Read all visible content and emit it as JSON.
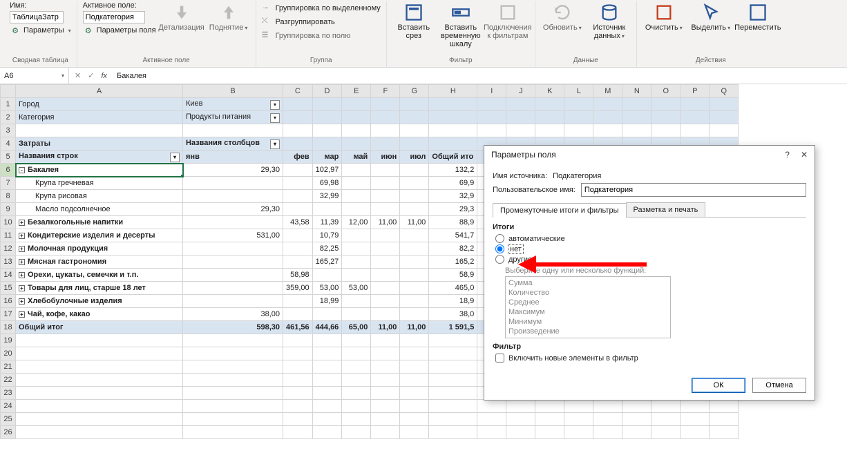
{
  "ribbon": {
    "group1": {
      "name_label": "Имя:",
      "name_value": "ТаблицаЗатр",
      "params_label": "Параметры",
      "group_label": "Сводная таблица"
    },
    "group2": {
      "active_label": "Активное поле:",
      "active_value": "Подкатегория",
      "field_params": "Параметры поля",
      "detail": "Детализация",
      "raise": "Поднятие",
      "group_label": "Активное поле"
    },
    "group3": {
      "by_selection": "Группировка по выделенному",
      "ungroup": "Разгруппировать",
      "by_field": "Группировка по полю",
      "group_label": "Группа"
    },
    "group4": {
      "slicer1": "Вставить",
      "slicer2": "срез",
      "timeline1": "Вставить",
      "timeline2": "временную шкалу",
      "connections1": "Подключения",
      "connections2": "к фильтрам",
      "group_label": "Фильтр"
    },
    "group5": {
      "refresh": "Обновить",
      "source1": "Источник",
      "source2": "данных",
      "group_label": "Данные"
    },
    "group6": {
      "clear": "Очистить",
      "select": "Выделить",
      "move": "Переместить",
      "group_label": "Действия"
    }
  },
  "namebox": {
    "value": "A6"
  },
  "formula": {
    "value": "Бакалея"
  },
  "columns": [
    "A",
    "B",
    "C",
    "D",
    "E",
    "F",
    "G",
    "H",
    "I",
    "J",
    "K",
    "L",
    "M",
    "N",
    "O",
    "P",
    "Q"
  ],
  "sheet": {
    "filterRows": [
      {
        "row": 1,
        "label": "Город",
        "value": "Киев"
      },
      {
        "row": 2,
        "label": "Категория",
        "value": "Продукты питания"
      }
    ],
    "pivotHeader": {
      "row": 4,
      "rowLabel": "Затраты",
      "colLabel": "Названия столбцов"
    },
    "colLabels": {
      "row": 5,
      "rowField": "Названия строк",
      "cols": [
        "янв",
        "фев",
        "мар",
        "май",
        "июн",
        "июл"
      ],
      "total": "Общий ито"
    },
    "rows": [
      {
        "n": 6,
        "type": "cat",
        "exp": "-",
        "label": "Бакалея",
        "vals": [
          "29,30",
          "",
          "102,97",
          "",
          "",
          ""
        ],
        "total": "132,2",
        "selected": true
      },
      {
        "n": 7,
        "type": "det",
        "label": "Крупа гречневая",
        "vals": [
          "",
          "",
          "69,98",
          "",
          "",
          ""
        ],
        "total": "69,9"
      },
      {
        "n": 8,
        "type": "det",
        "label": "Крупа рисовая",
        "vals": [
          "",
          "",
          "32,99",
          "",
          "",
          ""
        ],
        "total": "32,9"
      },
      {
        "n": 9,
        "type": "det",
        "label": "Масло подсолнечное",
        "vals": [
          "29,30",
          "",
          "",
          "",
          "",
          ""
        ],
        "total": "29,3"
      },
      {
        "n": 10,
        "type": "cat",
        "exp": "+",
        "label": "Безалкогольные напитки",
        "vals": [
          "",
          "43,58",
          "11,39",
          "12,00",
          "11,00",
          "11,00"
        ],
        "total": "88,9"
      },
      {
        "n": 11,
        "type": "cat",
        "exp": "+",
        "label": "Кондитерские изделия и десерты",
        "vals": [
          "531,00",
          "",
          "10,79",
          "",
          "",
          ""
        ],
        "total": "541,7"
      },
      {
        "n": 12,
        "type": "cat",
        "exp": "+",
        "label": "Молочная продукция",
        "vals": [
          "",
          "",
          "82,25",
          "",
          "",
          ""
        ],
        "total": "82,2"
      },
      {
        "n": 13,
        "type": "cat",
        "exp": "+",
        "label": "Мясная гастрономия",
        "vals": [
          "",
          "",
          "165,27",
          "",
          "",
          ""
        ],
        "total": "165,2"
      },
      {
        "n": 14,
        "type": "cat",
        "exp": "+",
        "label": "Орехи, цукаты, семечки и т.п.",
        "vals": [
          "",
          "58,98",
          "",
          "",
          "",
          ""
        ],
        "total": "58,9"
      },
      {
        "n": 15,
        "type": "cat",
        "exp": "+",
        "label": "Товары для лиц, старше 18 лет",
        "vals": [
          "",
          "359,00",
          "53,00",
          "53,00",
          "",
          ""
        ],
        "total": "465,0"
      },
      {
        "n": 16,
        "type": "cat",
        "exp": "+",
        "label": "Хлебобулочные изделия",
        "vals": [
          "",
          "",
          "18,99",
          "",
          "",
          ""
        ],
        "total": "18,9"
      },
      {
        "n": 17,
        "type": "cat",
        "exp": "+",
        "label": "Чай, кофе, какао",
        "vals": [
          "38,00",
          "",
          "",
          "",
          "",
          ""
        ],
        "total": "38,0"
      },
      {
        "n": 18,
        "type": "total",
        "label": "Общий итог",
        "vals": [
          "598,30",
          "461,56",
          "444,66",
          "65,00",
          "11,00",
          "11,00"
        ],
        "total": "1 591,5"
      }
    ],
    "emptyRows": [
      3,
      19,
      20,
      21,
      22,
      23,
      24,
      25,
      26
    ]
  },
  "dialog": {
    "title": "Параметры поля",
    "source_label": "Имя источника:",
    "source_value": "Подкатегория",
    "custom_label": "Пользовательское имя:",
    "custom_value": "Подкатегория",
    "tab1": "Промежуточные итоги и фильтры",
    "tab2": "Разметка и печать",
    "section_totals": "Итоги",
    "radio_auto": "автоматические",
    "radio_none": "нет",
    "radio_other": "другие",
    "funcs_label": "Выберите одну или несколько функций:",
    "funcs": [
      "Сумма",
      "Количество",
      "Среднее",
      "Максимум",
      "Минимум",
      "Произведение"
    ],
    "section_filter": "Фильтр",
    "chk_newitems": "Включить новые элементы в фильтр",
    "btn_ok": "ОК",
    "btn_cancel": "Отмена"
  }
}
